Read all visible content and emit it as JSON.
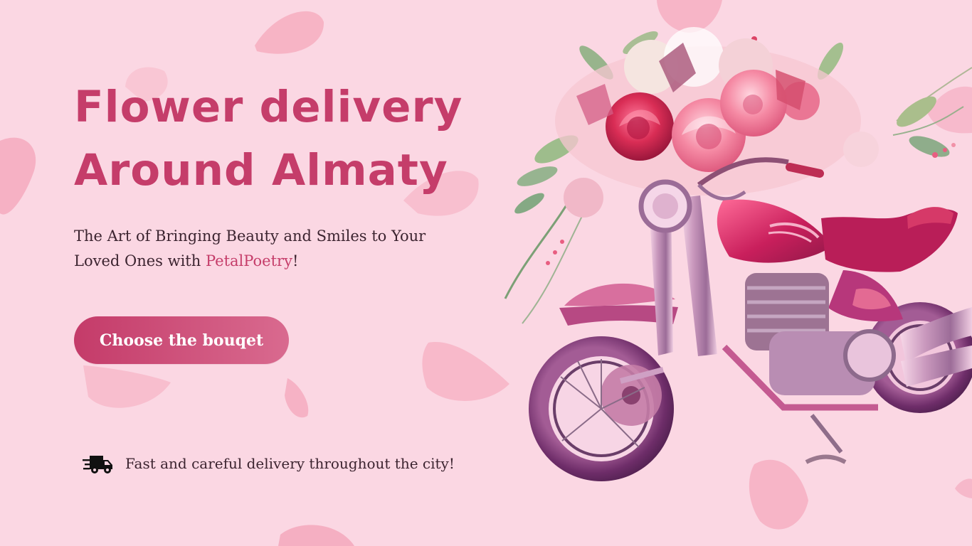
{
  "hero": {
    "headline_line1": "Flower delivery",
    "headline_line2": "Around Almaty",
    "subtitle_before": "The Art of Bringing Beauty and Smiles  to Your Loved Ones with ",
    "brand": "PetalPoetry",
    "subtitle_after": "!",
    "cta_label": "Choose the bouqet",
    "delivery_text": "Fast and careful delivery throughout the city!"
  },
  "icons": {
    "delivery": "truck-icon",
    "illustration": "motorcycle-with-flower-bouquet-illustration",
    "background": "falling-petals"
  },
  "colors": {
    "background": "#fbd7e3",
    "accent": "#c53d6a",
    "button_gradient_end": "#d96a8f",
    "body_text": "#3c2430"
  }
}
